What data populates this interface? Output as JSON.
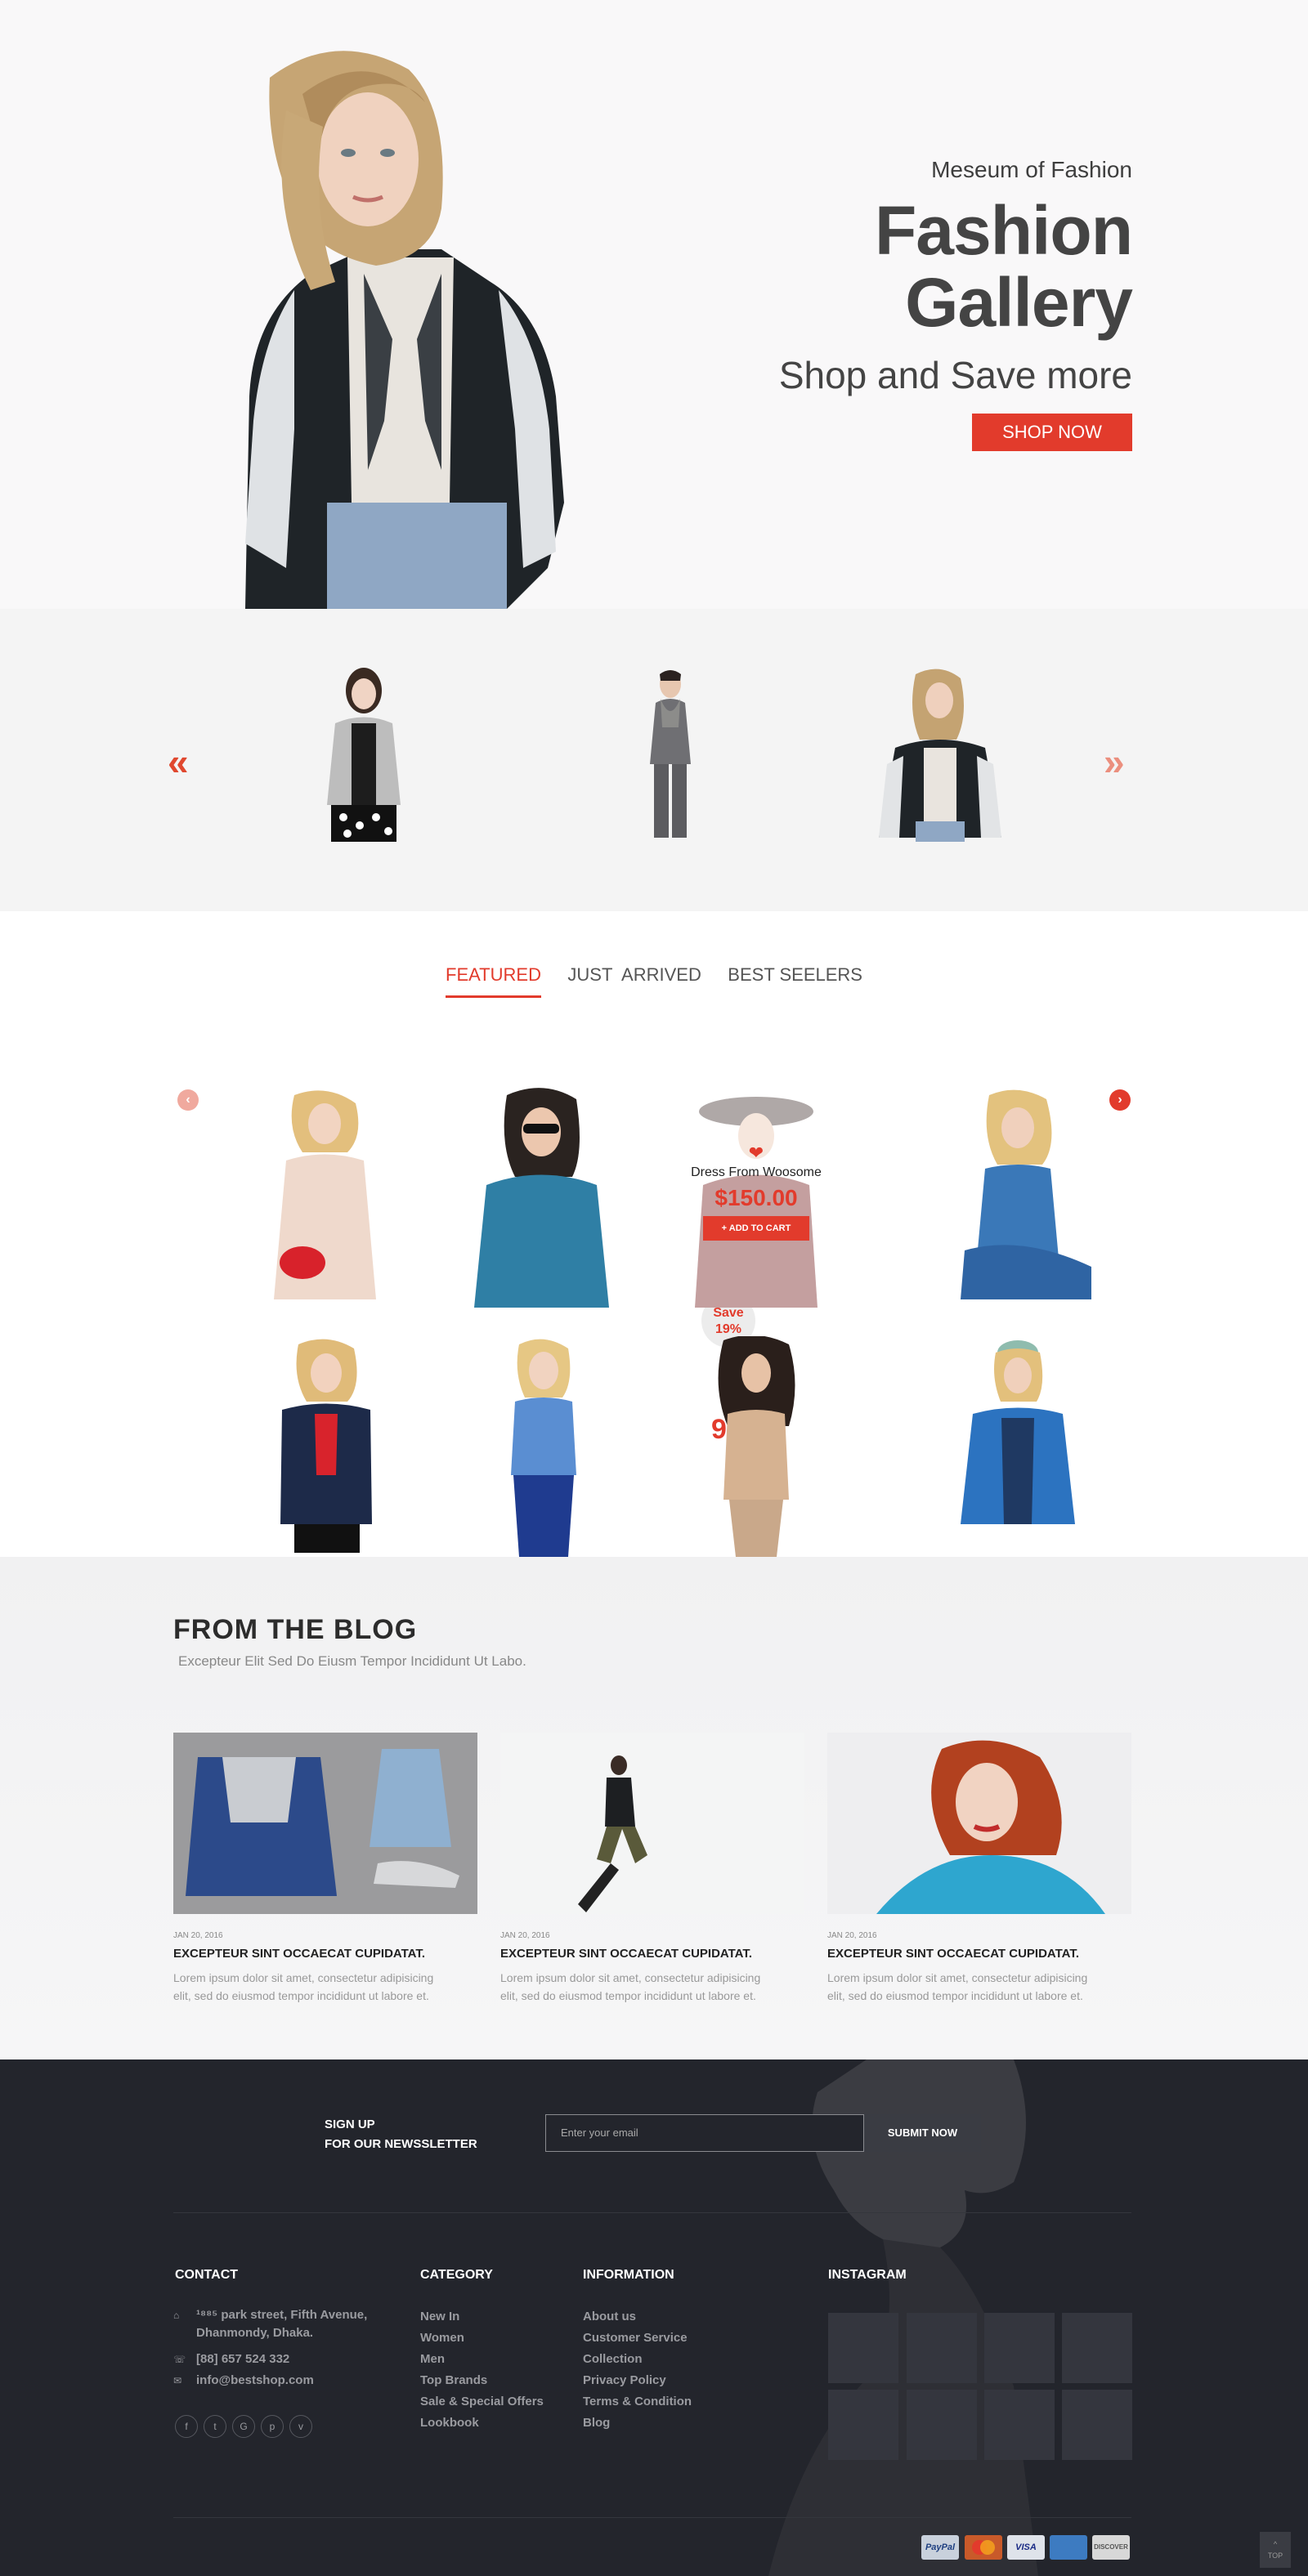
{
  "hero": {
    "kicker": "Meseum of Fashion",
    "title_line1": "Fashion",
    "title_line2": "Gallery",
    "subtitle": "Shop and Save more",
    "button": "SHOP NOW"
  },
  "carousel": {
    "prev_icon": "«",
    "next_icon": "»",
    "save_line1": "Save",
    "save_line2": "19%",
    "price": "99$"
  },
  "tabs": [
    "FEATURED",
    "JUST  ARRIVED",
    "BEST SEELERS"
  ],
  "product_overlay": {
    "name": "Dress From Woosome",
    "price": "$150.00",
    "button": "+ ADD TO CART"
  },
  "blog": {
    "title": "FROM THE BLOG",
    "subtitle": "Excepteur Elit Sed Do Eiusm Tempor Incididunt Ut Labo.",
    "posts": [
      {
        "date": "JAN 20, 2016",
        "title": "EXCEPTEUR SINT OCCAECAT CUPIDATAT.",
        "text_line1": "Lorem ipsum dolor sit amet, consectetur adipisicing",
        "text_line2": "elit, sed do eiusmod tempor incididunt ut labore et."
      },
      {
        "date": "JAN 20, 2016",
        "title": "EXCEPTEUR SINT OCCAECAT CUPIDATAT.",
        "text_line1": "Lorem ipsum dolor sit amet, consectetur adipisicing",
        "text_line2": "elit, sed do eiusmod tempor incididunt ut labore et."
      },
      {
        "date": "JAN 20, 2016",
        "title": "EXCEPTEUR SINT OCCAECAT CUPIDATAT.",
        "text_line1": "Lorem ipsum dolor sit amet, consectetur adipisicing",
        "text_line2": "elit, sed do eiusmod tempor incididunt ut labore et."
      }
    ]
  },
  "newsletter": {
    "label_line1": "SIGN UP",
    "label_line2": "FOR OUR NEWSSLETTER",
    "placeholder": "Enter your email",
    "button": "SUBMIT NOW"
  },
  "footer": {
    "contact": {
      "heading": "CONTACT",
      "address_line1": "¹⁸⁸⁵ park street, Fifth Avenue,",
      "address_line2": "Dhanmondy, Dhaka.",
      "phone": "[88] 657 524 332",
      "email": "info@bestshop.com"
    },
    "category": {
      "heading": "CATEGORY",
      "items": [
        "New In",
        "Women",
        "Men",
        "Top Brands",
        "Sale & Special Offers",
        "Lookbook"
      ]
    },
    "information": {
      "heading": "INFORMATION",
      "items": [
        "About us",
        "Customer Service",
        "Collection",
        "Privacy Policy",
        "Terms & Condition",
        "Blog"
      ]
    },
    "instagram": {
      "heading": "INSTAGRAM"
    },
    "social_icons": [
      "facebook-icon",
      "twitter-icon",
      "google-plus-icon",
      "pinterest-icon",
      "vimeo-icon"
    ],
    "payments": [
      "PayPal",
      "",
      "VISA",
      "",
      "DISCOVER"
    ],
    "top_label": "TOP"
  },
  "colors": {
    "accent": "#e23b2c",
    "footer_bg": "#23252c"
  }
}
